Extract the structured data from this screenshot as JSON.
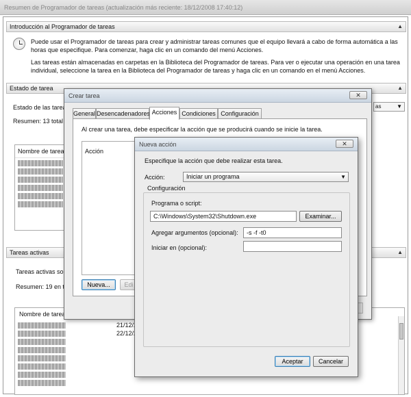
{
  "window_title": "Resumen de Programador de tareas (actualización más reciente: 18/12/2008 17:40:12)",
  "sections": {
    "intro": {
      "header": "Introducción al Programador de tareas",
      "para1": "Puede usar el Programador de tareas para crear y administrar tareas comunes que el equipo llevará a cabo de forma automática a las horas que especifique. Para comenzar, haga clic en un comando del menú Acciones.",
      "para2": "Las tareas están almacenadas en carpetas en la Biblioteca del Programador de tareas. Para ver o ejecutar una operación en una tarea individual, seleccione la tarea en la Biblioteca del Programador de tareas y haga clic en un comando en el menú Acciones."
    },
    "status": {
      "header": "Estado de tarea",
      "label": "Estado de las tareas",
      "summary": "Resumen: 13 total -",
      "column": "Nombre de tarea",
      "dropdown_text": "as"
    },
    "active": {
      "header": "Tareas activas",
      "label": "Tareas activas son",
      "summary": "Resumen: 19 en tot",
      "column": "Nombre de tarea",
      "dates": [
        "21/12/20",
        "22/12/20"
      ]
    }
  },
  "dialog_crear": {
    "title": "Crear tarea",
    "tabs": [
      "General",
      "Desencadenadores",
      "Acciones",
      "Condiciones",
      "Configuración"
    ],
    "active_tab": "Acciones",
    "instruction": "Al crear una tarea, debe especificar la acción que se producirá cuando se inicie la tarea.",
    "column_action": "Acción",
    "new_button": "Nueva...",
    "edit_button": "Edi"
  },
  "dialog_nueva": {
    "title": "Nueva acción",
    "instruction": "Especifique la acción que debe realizar esta tarea.",
    "action_label": "Acción:",
    "action_value": "Iniciar un programa",
    "config_label": "Configuración",
    "program_label": "Programa o script:",
    "program_value": "C:\\Windows\\System32\\Shutdown.exe",
    "browse_button": "Examinar...",
    "args_label": "Agregar argumentos (opcional):",
    "args_value": "-s -f -t0",
    "startin_label": "Iniciar en (opcional):",
    "startin_value": "",
    "ok_button": "Aceptar",
    "cancel_button": "Cancelar"
  },
  "icons": {
    "clock": "clock-icon",
    "close": "close-icon",
    "collapse": "chevron-up-icon",
    "dropdown": "chevron-down-icon"
  }
}
